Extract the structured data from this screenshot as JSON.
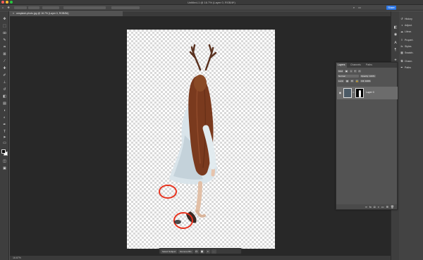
{
  "window": {
    "title": "Untitled-1 @ 16.7% (Layer 0, RGB/8*)"
  },
  "options_bar": {
    "share_label": "Share"
  },
  "document_tab": {
    "label": "unsplash-photo.jpg @ 16.7% (Layer 0, RGB/8#)"
  },
  "context_bar": {
    "select_subject": "Select Subject",
    "remove_bg": "Remove BG",
    "more": "···"
  },
  "status": {
    "zoom": "16.67%"
  },
  "right_panel": {
    "items": [
      {
        "icon": "history-icon",
        "label": "History"
      },
      {
        "icon": "adjust-icon",
        "label": "Adjust."
      },
      {
        "icon": "libraries-icon",
        "label": "Librar."
      },
      {
        "icon": "properties-icon",
        "label": "Propert."
      },
      {
        "icon": "styles-icon",
        "label": "Styles"
      },
      {
        "icon": "swatches-icon",
        "label": "Swatch."
      },
      {
        "icon": "channels-icon",
        "label": "Chann."
      },
      {
        "icon": "paths-icon",
        "label": "Paths"
      },
      {
        "icon": "layers-icon",
        "label": "Layers"
      }
    ]
  },
  "layers_panel": {
    "tabs": [
      "Layers",
      "Channels",
      "Paths"
    ],
    "kind_label": "Kind",
    "blend_mode": "Normal",
    "opacity_label": "Opacity: 100%",
    "lock_label": "Lock:",
    "fill_label": "Fill: 100%",
    "layer_name": "Layer 0"
  },
  "accent_colors": {
    "share_button": "#2d78e8",
    "annotation_circles": "#e8321e"
  }
}
